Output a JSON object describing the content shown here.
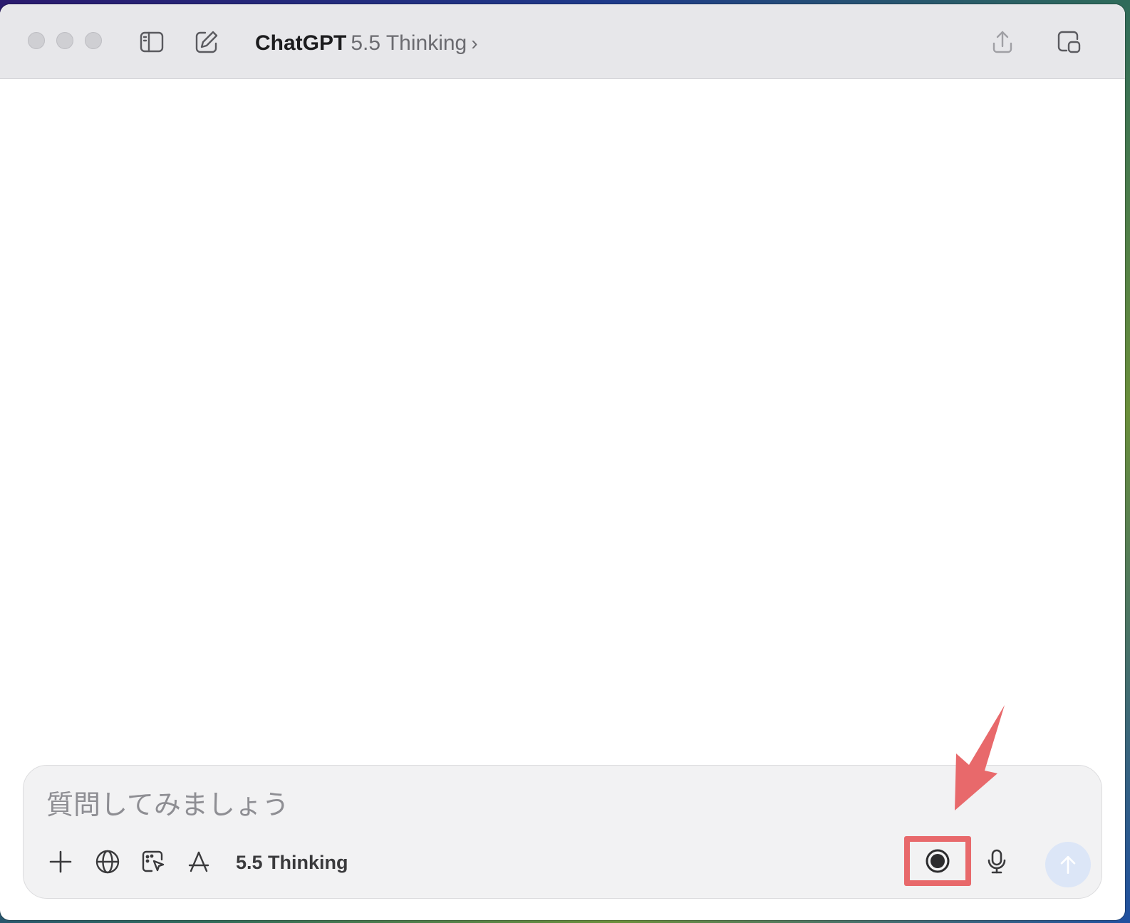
{
  "titlebar": {
    "app_name": "ChatGPT",
    "model": "5.5 Thinking",
    "chevron": "›"
  },
  "composer": {
    "placeholder": "質問してみましょう",
    "model_label": "5.5 Thinking"
  },
  "icons": {
    "close": "close-button",
    "minimize": "minimize-button",
    "zoom": "zoom-button",
    "sidebar": "sidebar-icon",
    "new_chat": "compose-icon",
    "share": "share-icon",
    "window_mode": "window-mode-icon",
    "add": "plus-icon",
    "web": "globe-icon",
    "canvas": "canvas-icon",
    "tools": "tools-icon",
    "record": "record-icon",
    "mic": "microphone-icon",
    "send": "arrow-up-icon"
  },
  "colors": {
    "annotation": "#e8696b",
    "send_disabled": "#dce6f7"
  }
}
